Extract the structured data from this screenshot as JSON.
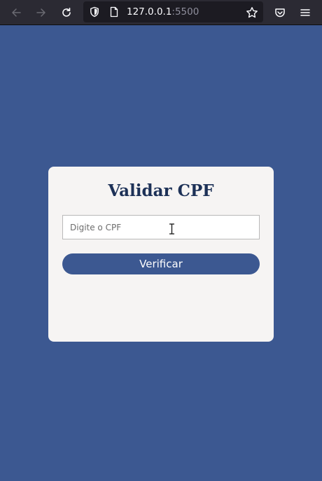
{
  "browser": {
    "url_host": "127.0.0.1",
    "url_port": ":5500",
    "icons": {
      "back": "arrow-left-icon",
      "forward": "arrow-right-icon",
      "reload": "reload-icon",
      "tracking": "shield-icon",
      "page": "page-icon",
      "bookmark": "star-icon",
      "pocket": "pocket-icon",
      "menu": "hamburger-menu-icon"
    }
  },
  "form": {
    "title": "Validar CPF",
    "input_placeholder": "Digite o CPF",
    "input_value": "",
    "submit_label": "Verificar"
  },
  "colors": {
    "page_background": "#3c5891",
    "card_background": "#f6f4f3",
    "title_color": "#1d3157",
    "button_background": "#3c5891",
    "button_text": "#ffffff"
  }
}
